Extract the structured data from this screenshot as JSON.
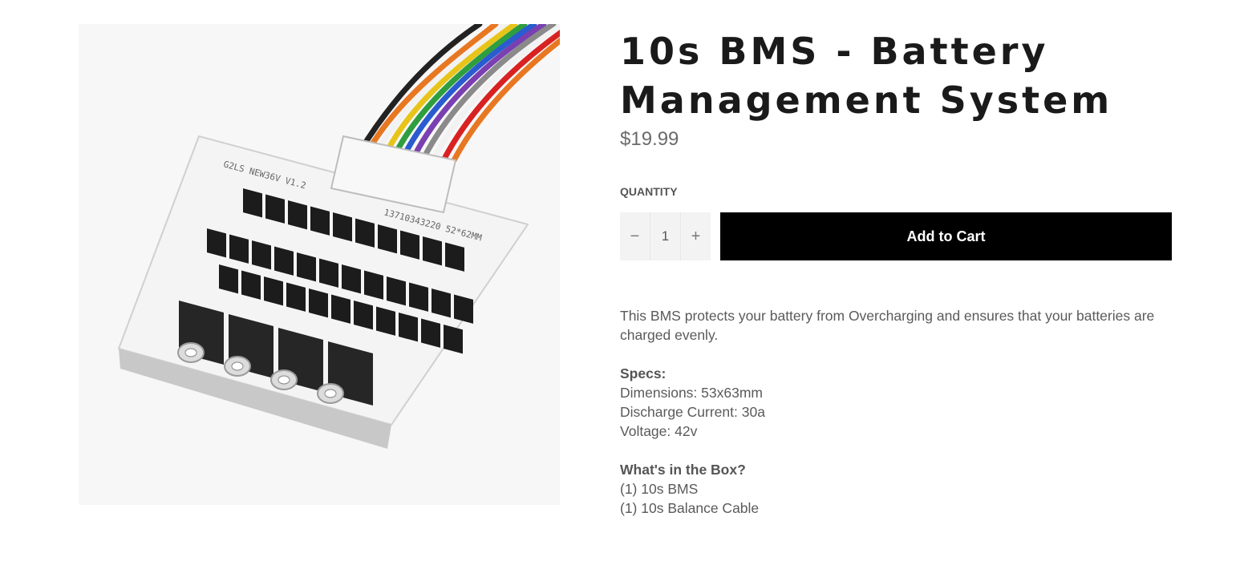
{
  "product": {
    "image_alt": "10s BMS circuit board with balance wires",
    "title_line1": "10s BMS - Battery",
    "title_line2": "Management System",
    "price": "$19.99"
  },
  "quantity": {
    "label": "QUANTITY",
    "minus_symbol": "−",
    "value": "1",
    "plus_symbol": "+"
  },
  "cart": {
    "add_label": "Add to Cart"
  },
  "description": {
    "intro": "This BMS protects your battery from Overcharging and ensures that your batteries are charged evenly.",
    "specs_heading": "Specs:",
    "specs": [
      "Dimensions: 53x63mm",
      "Discharge Current: 30a",
      "Voltage: 42v"
    ],
    "box_heading": "What's in the Box?",
    "box_items": [
      "(1) 10s BMS",
      "(1) 10s Balance Cable"
    ]
  },
  "board_print": {
    "line1": "G2LS  NEW36V V1.2",
    "line2": "13710343220  52*62MM"
  },
  "colors": {
    "button_bg": "#000000",
    "button_text": "#ffffff",
    "title": "#1a1a1a",
    "price": "#6b6b6b"
  }
}
